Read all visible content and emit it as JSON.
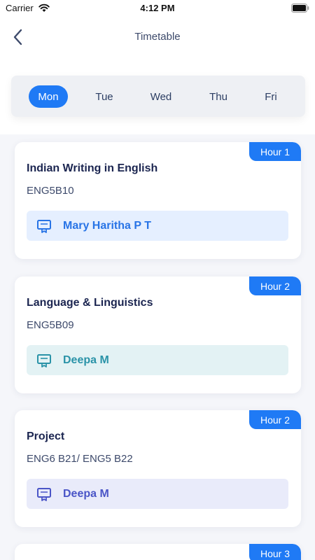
{
  "status_bar": {
    "carrier": "Carrier",
    "time": "4:12 PM"
  },
  "header": {
    "title": "Timetable"
  },
  "days": [
    {
      "label": "Mon",
      "active": true
    },
    {
      "label": "Tue",
      "active": false
    },
    {
      "label": "Wed",
      "active": false
    },
    {
      "label": "Thu",
      "active": false
    },
    {
      "label": "Fri",
      "active": false
    }
  ],
  "colors": {
    "accent": "#1f7af5",
    "teacher_blue_bg": "#e5efff",
    "teacher_blue_fg": "#2874e6",
    "teacher_teal_bg": "#e3f2f4",
    "teacher_teal_fg": "#2a93a8",
    "teacher_purple_bg": "#e9ebfa",
    "teacher_purple_fg": "#4a55c7"
  },
  "classes": [
    {
      "hour": "Hour 1",
      "title": "Indian Writing  in English",
      "code": "ENG5B10",
      "teacher": "Mary Haritha P T",
      "icon": "certificate-icon"
    },
    {
      "hour": "Hour 2",
      "title": "Language & Linguistics",
      "code": "ENG5B09",
      "teacher": "Deepa M",
      "icon": "certificate-icon"
    },
    {
      "hour": "Hour 2",
      "title": "Project",
      "code": "ENG6 B21/ ENG5 B22",
      "teacher": "Deepa M",
      "icon": "certificate-icon"
    },
    {
      "hour": "Hour 3"
    }
  ]
}
